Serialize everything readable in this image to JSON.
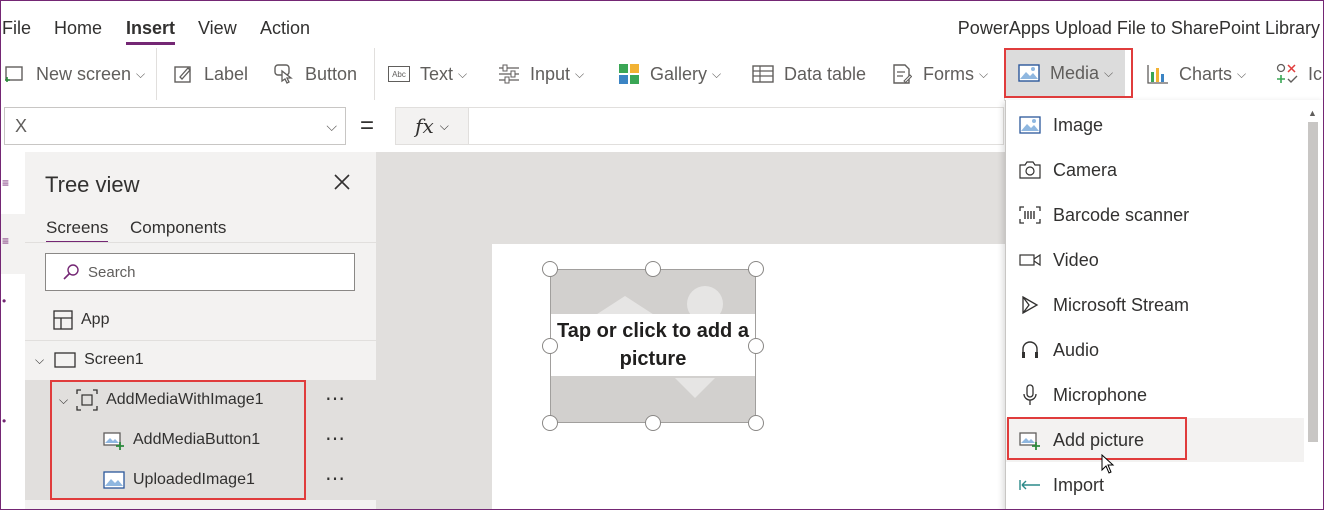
{
  "menubar": {
    "items": [
      "File",
      "Home",
      "Insert",
      "View",
      "Action"
    ],
    "active": "Insert",
    "app_title": "PowerApps Upload File to SharePoint Library"
  },
  "ribbon": {
    "new_screen": "New screen",
    "label": "Label",
    "button": "Button",
    "text": "Text",
    "input": "Input",
    "gallery": "Gallery",
    "data_table": "Data table",
    "forms": "Forms",
    "media": "Media",
    "charts": "Charts",
    "icons": "Ic",
    "text_icon_glyph": "Abc"
  },
  "formula_bar": {
    "property": "X",
    "equals": "=",
    "fx": "fx",
    "formula": ""
  },
  "tree_view": {
    "title": "Tree view",
    "tabs": [
      "Screens",
      "Components"
    ],
    "active_tab": "Screens",
    "search_placeholder": "Search",
    "items": {
      "app": "App",
      "screen1": "Screen1",
      "group": "AddMediaWithImage1",
      "add_media_button": "AddMediaButton1",
      "uploaded_image": "UploadedImage1"
    },
    "more": "⋯"
  },
  "canvas": {
    "placeholder_text": "Tap or click to add a picture"
  },
  "media_menu": {
    "items": [
      {
        "label": "Image",
        "icon": "image-icon"
      },
      {
        "label": "Camera",
        "icon": "camera-icon"
      },
      {
        "label": "Barcode scanner",
        "icon": "barcode-icon"
      },
      {
        "label": "Video",
        "icon": "video-icon"
      },
      {
        "label": "Microsoft Stream",
        "icon": "stream-icon"
      },
      {
        "label": "Audio",
        "icon": "audio-icon"
      },
      {
        "label": "Microphone",
        "icon": "microphone-icon"
      },
      {
        "label": "Add picture",
        "icon": "add-picture-icon"
      },
      {
        "label": "Import",
        "icon": "import-icon"
      }
    ],
    "highlighted": "Add picture"
  },
  "colors": {
    "accent": "#742774",
    "highlight_box": "#e03c3c",
    "tree_bg": "#f3f2f1",
    "canvas_bg": "#e1dfdd"
  }
}
